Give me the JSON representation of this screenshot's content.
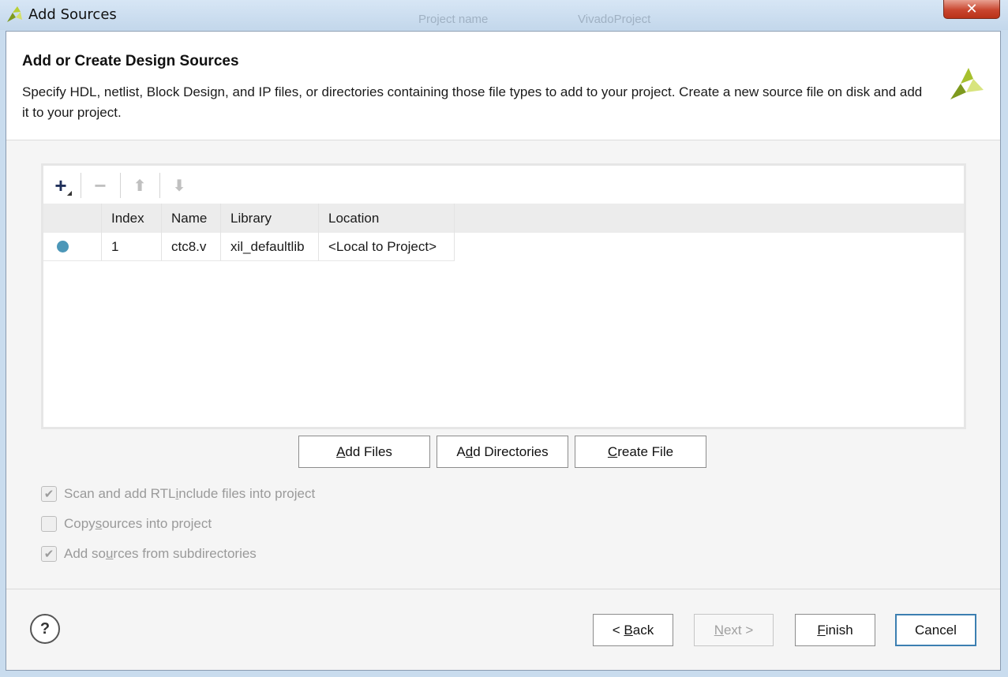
{
  "window": {
    "title": "Add Sources",
    "close_symbol": "✕",
    "background_hint": [
      "Project name",
      "VivadoProject"
    ]
  },
  "header": {
    "title": "Add or Create Design Sources",
    "description": "Specify HDL, netlist, Block Design, and IP files, or directories containing those file types to add to your project. Create a new source file on disk and add it to your project.",
    "logo_icon": "xilinx-logo-icon"
  },
  "toolbar": {
    "add_symbol": "+",
    "remove_symbol": "−",
    "up_symbol": "⬆",
    "down_symbol": "⬇"
  },
  "table": {
    "columns": [
      "",
      "Index",
      "Name",
      "Library",
      "Location"
    ],
    "rows": [
      {
        "status_icon": "dot",
        "index": "1",
        "name": "ctc8.v",
        "library": "xil_defaultlib",
        "location": "<Local to Project>"
      }
    ]
  },
  "actions": {
    "add_files": {
      "pre": "",
      "key": "A",
      "post": "dd Files"
    },
    "add_directories": {
      "pre": "A",
      "key": "d",
      "post": "d Directories"
    },
    "create_file": {
      "pre": "",
      "key": "C",
      "post": "reate File"
    }
  },
  "options": [
    {
      "pre": "Scan and add RTL ",
      "key": "i",
      "post": "nclude files into project",
      "checked": true
    },
    {
      "pre": "Copy ",
      "key": "s",
      "post": "ources into project",
      "checked": false
    },
    {
      "pre": "Add so",
      "key": "u",
      "post": "rces from subdirectories",
      "checked": true
    }
  ],
  "footer": {
    "help": "?",
    "back": {
      "pre": "< ",
      "key": "B",
      "post": "ack"
    },
    "next": {
      "pre": "",
      "key": "N",
      "post": "ext >"
    },
    "finish": {
      "pre": "",
      "key": "F",
      "post": "inish"
    },
    "cancel": "Cancel"
  },
  "colors": {
    "accent": "#3c7fb1",
    "status_dot": "#4c97b8",
    "logo_green": "#9fbd2a"
  }
}
